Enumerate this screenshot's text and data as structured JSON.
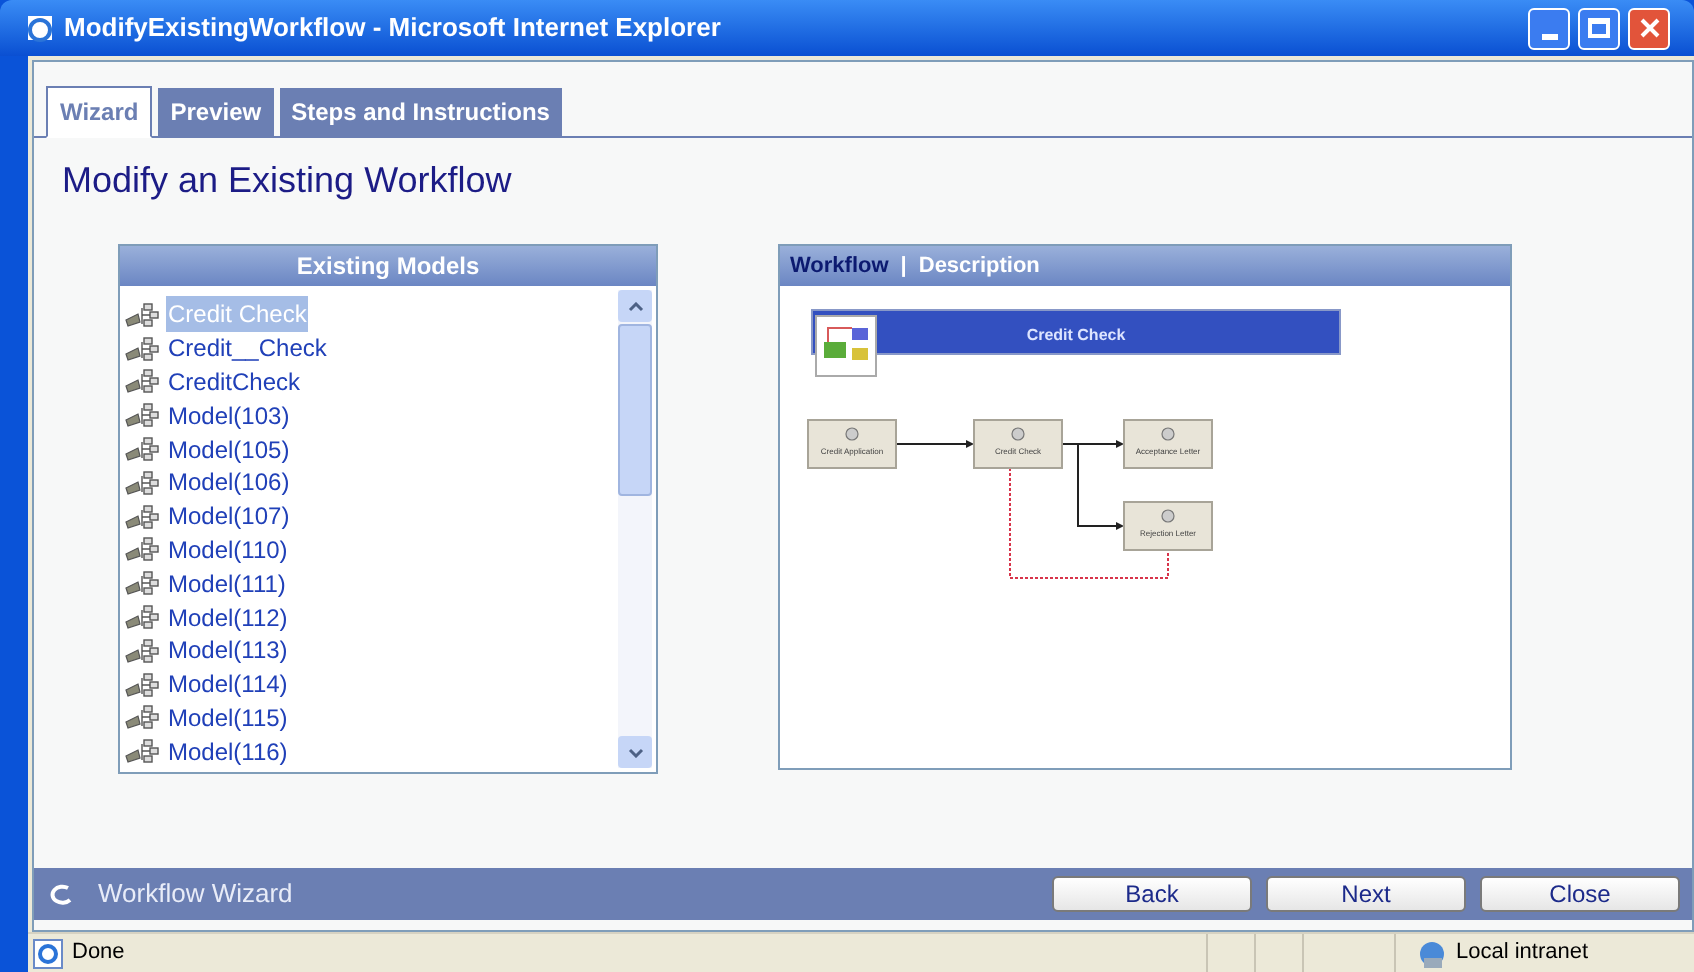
{
  "window": {
    "title": "ModifyExistingWorkflow - Microsoft Internet Explorer"
  },
  "tabs": [
    {
      "label": "Wizard",
      "selected": true
    },
    {
      "label": "Preview",
      "selected": false
    },
    {
      "label": "Steps and Instructions",
      "selected": false
    }
  ],
  "heading": "Modify an Existing Workflow",
  "models": {
    "title": "Existing Models",
    "items": [
      {
        "label": "Credit Check",
        "selected": true
      },
      {
        "label": "Credit__Check",
        "selected": false
      },
      {
        "label": "CreditCheck",
        "selected": false
      },
      {
        "label": "Model(103)",
        "selected": false
      },
      {
        "label": "Model(105)",
        "selected": false
      },
      {
        "label": "Model(106)",
        "selected": false
      },
      {
        "label": "Model(107)",
        "selected": false
      },
      {
        "label": "Model(110)",
        "selected": false
      },
      {
        "label": "Model(111)",
        "selected": false
      },
      {
        "label": "Model(112)",
        "selected": false
      },
      {
        "label": "Model(113)",
        "selected": false
      },
      {
        "label": "Model(114)",
        "selected": false
      },
      {
        "label": "Model(115)",
        "selected": false
      },
      {
        "label": "Model(116)",
        "selected": false
      }
    ]
  },
  "preview": {
    "tabs": [
      {
        "label": "Workflow",
        "selected": true
      },
      {
        "label": "Description",
        "selected": false
      }
    ],
    "separator": "|",
    "diagram": {
      "title": "Credit Check",
      "nodes": [
        "Credit Application",
        "Credit Check",
        "Acceptance Letter",
        "Rejection Letter"
      ]
    }
  },
  "footer": {
    "title": "Workflow Wizard",
    "buttons": [
      "Back",
      "Next",
      "Close"
    ]
  },
  "status_bar": {
    "status": "Done",
    "zone": "Local intranet"
  }
}
